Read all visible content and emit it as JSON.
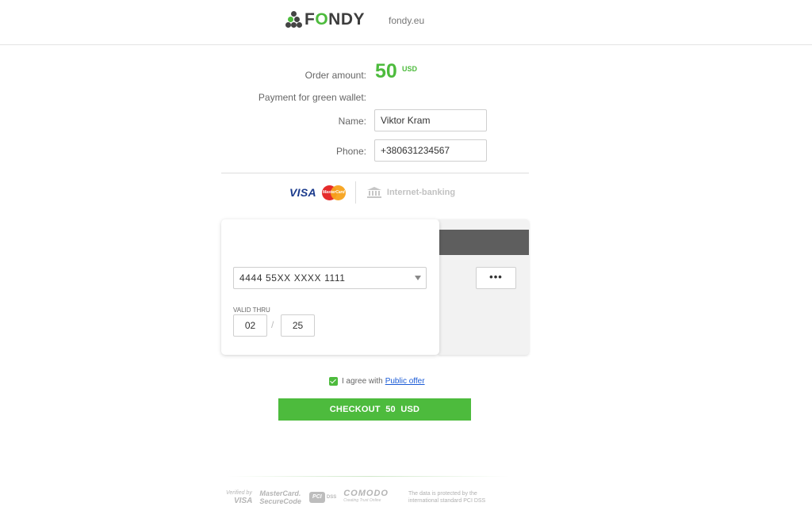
{
  "header": {
    "brand": "FONDY",
    "site_link": "fondy.eu"
  },
  "order": {
    "amount_label": "Order amount:",
    "amount": "50",
    "currency": "USD",
    "description": "Payment for green wallet:"
  },
  "form": {
    "name_label": "Name:",
    "name_value": "Viktor Kram",
    "phone_label": "Phone:",
    "phone_value": "+380631234567"
  },
  "payment_methods": {
    "visa": "VISA",
    "mastercard": "MasterCard",
    "internet_banking": "Internet-banking"
  },
  "card": {
    "number": "4444 55XX XXXX 1111",
    "valid_thru_label": "VALID THRU",
    "exp_month": "02",
    "exp_separator": "/",
    "exp_year": "25",
    "cvv": "•••"
  },
  "agreement": {
    "text": "I agree with",
    "link": "Public offer",
    "checked": true
  },
  "checkout": {
    "label": "CHECKOUT  50  USD"
  },
  "footer": {
    "verified_line1": "Verified by",
    "verified_line2": "VISA",
    "mc_line1": "MasterCard.",
    "mc_line2": "SecureCode",
    "pci": "PCI",
    "pci_dss": "DSS",
    "comodo": "COMODO",
    "comodo_slogan": "Creating Trust Online",
    "note": "The data is protected by the international standard PCI DSS"
  },
  "colors": {
    "accent": "#4dbb3d",
    "link": "#1b5bd6",
    "stripe": "#5e5e5e"
  }
}
